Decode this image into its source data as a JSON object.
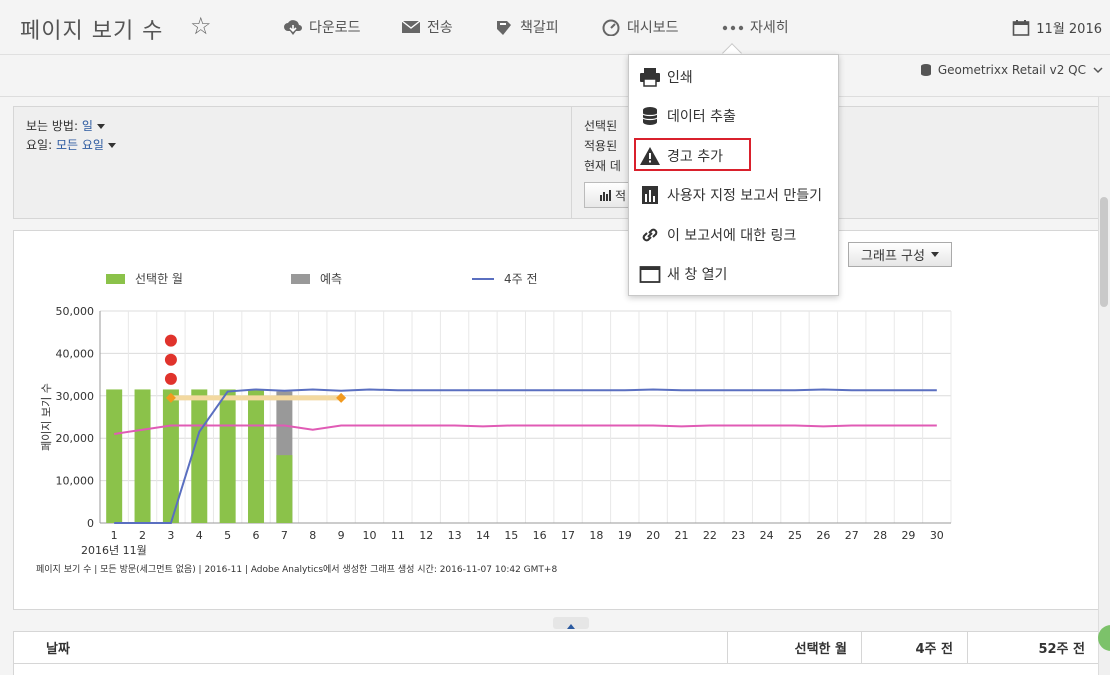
{
  "header": {
    "title": "페이지 보기 수",
    "toolbar": [
      {
        "label": "다운로드",
        "icon": "cloud-download-icon"
      },
      {
        "label": "전송",
        "icon": "envelope-icon"
      },
      {
        "label": "책갈피",
        "icon": "bookmark-icon"
      },
      {
        "label": "대시보드",
        "icon": "gauge-icon"
      },
      {
        "label": "자세히",
        "icon": "more-dots-icon"
      }
    ],
    "date": "11월 2016",
    "report_suite": "Geometrixx Retail v2 QC"
  },
  "options": {
    "view_by_label": "보는 방법: ",
    "view_by_value": "일",
    "day_label": "요일: ",
    "day_value": "모든 요일",
    "right_lines": [
      "선택된",
      "적용된",
      "현재 데"
    ],
    "small_button": "적"
  },
  "menu": {
    "items": [
      {
        "label": "인쇄",
        "icon": "printer-icon"
      },
      {
        "label": "데이터 추출",
        "icon": "database-icon"
      },
      {
        "label": "경고 추가",
        "icon": "warning-icon"
      },
      {
        "label": "사용자 지정 보고서 만들기",
        "icon": "report-icon"
      },
      {
        "label": "이 보고서에 대한 링크",
        "icon": "link-icon"
      },
      {
        "label": "새 창 열기",
        "icon": "window-icon"
      }
    ]
  },
  "graph_button": "그래프 구성",
  "legend": [
    "선택한 월",
    "예측",
    "4주 전"
  ],
  "chart_data": {
    "type": "bar",
    "ylabel": "페이지 보기 수",
    "xlabel": "2016년 11월",
    "ylim": [
      0,
      50000
    ],
    "yticks": [
      "0",
      "10,000",
      "20,000",
      "30,000",
      "40,000",
      "50,000"
    ],
    "categories": [
      "1",
      "2",
      "3",
      "4",
      "5",
      "6",
      "7",
      "8",
      "9",
      "10",
      "11",
      "12",
      "13",
      "14",
      "15",
      "16",
      "17",
      "18",
      "19",
      "20",
      "21",
      "22",
      "23",
      "24",
      "25",
      "26",
      "27",
      "28",
      "29",
      "30"
    ],
    "series": [
      {
        "name": "선택한 월",
        "values": [
          31500,
          31500,
          31500,
          31500,
          31500,
          31500,
          16000
        ]
      },
      {
        "name": "예측",
        "values": [
          null,
          null,
          null,
          null,
          null,
          null,
          31000
        ]
      },
      {
        "name": "4주 전",
        "values": [
          0,
          0,
          0,
          21500,
          31000,
          31500,
          31200,
          31500,
          31200,
          31500,
          31300,
          31300,
          31300,
          31300,
          31300,
          31300,
          31300,
          31300,
          31300,
          31500,
          31300,
          31300,
          31300,
          31300,
          31300,
          31500,
          31300,
          31300,
          31300,
          31300
        ]
      },
      {
        "values": [
          21000,
          22000,
          23000,
          23000,
          23000,
          23000,
          23000,
          22000,
          23000,
          23000,
          23000,
          23000,
          23000,
          22800,
          23000,
          23000,
          23000,
          23000,
          23000,
          23000,
          22800,
          23000,
          23000,
          23000,
          23000,
          22800,
          23000,
          23000,
          23000,
          23000
        ]
      }
    ],
    "alerts": [
      {
        "x": "3",
        "values": [
          43000,
          38500,
          34000
        ]
      }
    ],
    "forecast_band": {
      "from": "3",
      "to": "9",
      "value": 29500
    },
    "colors": {
      "selected": "#8bc24a",
      "forecast": "#999999",
      "prior": "#5a6fc0",
      "other": "#e05bb5",
      "alert": "#e0332c",
      "band": "#f3d9a0",
      "marker": "#f29a1f"
    }
  },
  "chart_footer": "페이지 보기 수 | 모든 방문(세그먼트 없음) | 2016-11 | Adobe Analytics에서 생성한 그래프 생성 시간: 2016-11-07 10:42 GMT+8",
  "table": {
    "columns": [
      "날짜",
      "선택한 월",
      "4주 전",
      "52주 전"
    ]
  }
}
